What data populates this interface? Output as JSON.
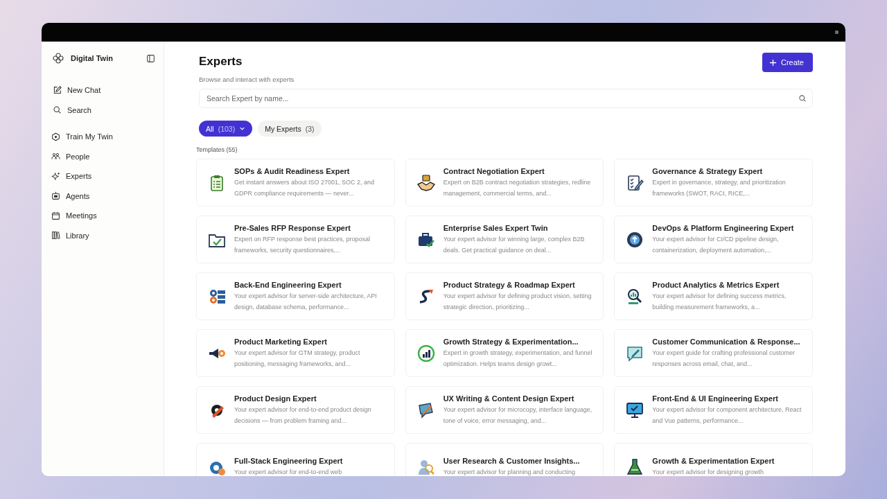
{
  "sidebar": {
    "brand": "Digital Twin",
    "actions": [
      {
        "label": "New Chat"
      },
      {
        "label": "Search"
      }
    ],
    "nav": [
      {
        "label": "Train My Twin"
      },
      {
        "label": "People"
      },
      {
        "label": "Experts"
      },
      {
        "label": "Agents"
      },
      {
        "label": "Meetings"
      },
      {
        "label": "Library"
      }
    ]
  },
  "header": {
    "title": "Experts",
    "subtitle": "Browse and interact with experts",
    "create_button": "Create"
  },
  "search": {
    "placeholder": "Search Expert by name..."
  },
  "tabs": [
    {
      "label": "All",
      "count": "(103)",
      "selected": true,
      "dropdown": true
    },
    {
      "label": "My Experts",
      "count": "(3)",
      "selected": false,
      "dropdown": false
    }
  ],
  "section_label": "Templates (55)",
  "cards": [
    {
      "title": "SOPs & Audit Readiness Expert",
      "description": "Get instant answers about ISO 27001, SOC 2, and GDPR compliance requirements — never..."
    },
    {
      "title": "Contract Negotiation Expert",
      "description": "Expert on B2B contract negotiation strategies, redline management, commercial terms, and..."
    },
    {
      "title": "Governance & Strategy Expert",
      "description": "Expert in governance, strategy, and prioritization frameworks (SWOT, RACI, RICE,..."
    },
    {
      "title": "Pre-Sales RFP Response Expert",
      "description": "Expert on RFP response best practices, proposal frameworks, security questionnaires,..."
    },
    {
      "title": "Enterprise Sales Expert Twin",
      "description": "Your expert advisor for winning large, complex B2B deals. Get practical guidance on deal..."
    },
    {
      "title": "DevOps & Platform Engineering Expert",
      "description": "Your expert advisor for CI/CD pipeline design, containerization, deployment automation,..."
    },
    {
      "title": "Back-End Engineering Expert",
      "description": "Your expert advisor for server-side architecture, API design, database schema, performance..."
    },
    {
      "title": "Product Strategy & Roadmap Expert",
      "description": "Your expert advisor for defining product vision, setting strategic direction, prioritizing..."
    },
    {
      "title": "Product Analytics & Metrics Expert",
      "description": "Your expert advisor for defining success metrics, building measurement frameworks, a..."
    },
    {
      "title": "Product Marketing Expert",
      "description": "Your expert advisor for GTM strategy, product positioning, messaging frameworks, and..."
    },
    {
      "title": "Growth Strategy & Experimentation...",
      "description": "Expert in growth strategy, experimentation, and funnel optimization. Helps teams design growt..."
    },
    {
      "title": "Customer Communication & Response...",
      "description": "Your expert guide for crafting professional customer responses across email, chat, and..."
    },
    {
      "title": "Product Design Expert",
      "description": "Your expert advisor for end-to-end product design decisions — from problem framing and..."
    },
    {
      "title": "UX Writing & Content Design Expert",
      "description": "Your expert advisor for microcopy, interface language, tone of voice, error messaging, and..."
    },
    {
      "title": "Front-End & UI Engineering Expert",
      "description": "Your expert advisor for component architecture, React and Vue patterns, performance..."
    },
    {
      "title": "Full-Stack Engineering Expert",
      "description": "Your expert advisor for end-to-end web"
    },
    {
      "title": "User Research & Customer Insights...",
      "description": "Your expert advisor for planning and conducting"
    },
    {
      "title": "Growth & Experimentation Expert",
      "description": "Your expert advisor for designing growth"
    }
  ]
}
